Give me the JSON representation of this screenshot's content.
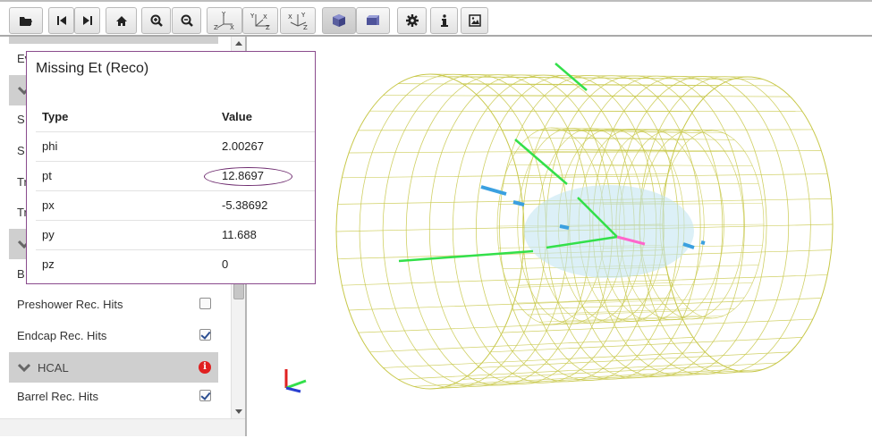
{
  "toolbar": {
    "buttons": [
      {
        "name": "open-file-button",
        "icon": "folder-open-icon"
      },
      {
        "name": "previous-event-button",
        "icon": "step-backward-icon"
      },
      {
        "name": "next-event-button",
        "icon": "step-forward-icon"
      },
      {
        "name": "home-button",
        "icon": "home-icon"
      },
      {
        "name": "zoom-in-button",
        "icon": "zoom-in-icon"
      },
      {
        "name": "zoom-out-button",
        "icon": "zoom-out-icon"
      },
      {
        "name": "view-xy-button",
        "icon": "axes-xy-icon"
      },
      {
        "name": "view-rz-button",
        "icon": "axes-rz-icon"
      },
      {
        "name": "view-3d-button",
        "icon": "axes-3d-icon"
      },
      {
        "name": "perspective-button",
        "icon": "perspective-cube-icon"
      },
      {
        "name": "orthographic-button",
        "icon": "orthographic-cube-icon"
      },
      {
        "name": "settings-button",
        "icon": "gear-icon"
      },
      {
        "name": "info-button",
        "icon": "info-icon"
      },
      {
        "name": "export-image-button",
        "icon": "image-icon"
      }
    ],
    "axis_labels": {
      "xy": [
        "Y",
        "Z",
        "X"
      ],
      "rz": [
        "Y",
        "X",
        "Z"
      ],
      "three_d": [
        "X",
        "Y",
        "Z"
      ]
    }
  },
  "sidebar": {
    "items": [
      {
        "label": "Ev",
        "type": "item"
      },
      {
        "label": "",
        "type": "category"
      },
      {
        "label": "S",
        "type": "item"
      },
      {
        "label": "S",
        "type": "item"
      },
      {
        "label": "Tr",
        "type": "item"
      },
      {
        "label": "Tr",
        "type": "item"
      },
      {
        "label": "",
        "type": "category"
      },
      {
        "label": "B",
        "type": "item"
      },
      {
        "label": "Preshower Rec. Hits",
        "type": "item",
        "checked": false
      },
      {
        "label": "Endcap Rec. Hits",
        "type": "item",
        "checked": true
      },
      {
        "label": "HCAL",
        "type": "category",
        "badge": "i"
      },
      {
        "label": "Barrel Rec. Hits",
        "type": "item",
        "checked": true
      }
    ]
  },
  "popup": {
    "title": "Missing Et (Reco)",
    "columns": [
      "Type",
      "Value"
    ],
    "rows": [
      {
        "type": "phi",
        "value": "2.00267"
      },
      {
        "type": "pt",
        "value": "12.8697"
      },
      {
        "type": "px",
        "value": "-5.38692"
      },
      {
        "type": "py",
        "value": "11.688"
      },
      {
        "type": "pz",
        "value": "0"
      }
    ],
    "highlighted_row": "pt"
  },
  "colors": {
    "geometry": "#c8c84a",
    "track": "#33e04a",
    "met": "#ff66cc",
    "hits": "#3aa0e0",
    "halo": "#bfe3f0",
    "popup_border": "#8a4b8d",
    "badge": "#e02020"
  }
}
